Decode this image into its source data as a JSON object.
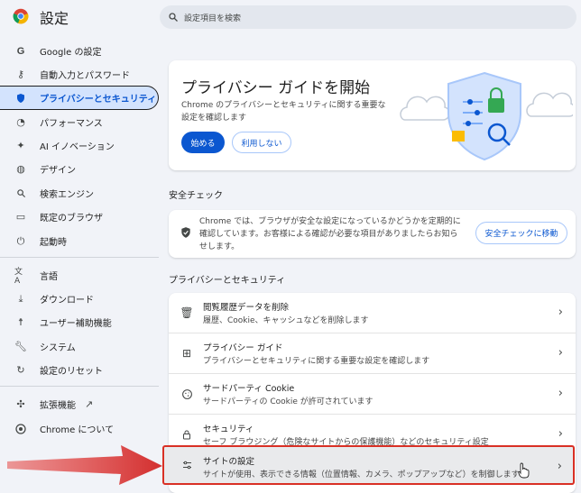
{
  "header": {
    "title": "設定",
    "search_placeholder": "設定項目を検索"
  },
  "sidebar": {
    "items": [
      {
        "label": "Google の設定",
        "icon": "google-icon"
      },
      {
        "label": "自動入力とパスワード",
        "icon": "key-icon"
      },
      {
        "label": "プライバシーとセキュリティ",
        "icon": "shield-icon",
        "active": true
      },
      {
        "label": "パフォーマンス",
        "icon": "speedometer-icon"
      },
      {
        "label": "AI イノベーション",
        "icon": "sparkle-icon"
      },
      {
        "label": "デザイン",
        "icon": "palette-icon"
      },
      {
        "label": "検索エンジン",
        "icon": "search-icon"
      },
      {
        "label": "既定のブラウザ",
        "icon": "browser-window-icon"
      },
      {
        "label": "起動時",
        "icon": "power-icon"
      },
      {
        "label": "言語",
        "icon": "translate-icon"
      },
      {
        "label": "ダウンロード",
        "icon": "download-icon"
      },
      {
        "label": "ユーザー補助機能",
        "icon": "accessibility-icon"
      },
      {
        "label": "システム",
        "icon": "wrench-icon"
      },
      {
        "label": "設定のリセット",
        "icon": "reset-icon"
      },
      {
        "label": "拡張機能",
        "icon": "puzzle-icon"
      },
      {
        "label": "Chrome について",
        "icon": "chrome-icon"
      }
    ]
  },
  "guide": {
    "title": "プライバシー ガイドを開始",
    "description": "Chrome のプライバシーとセキュリティに関する重要な設定を確認します",
    "start_label": "始める",
    "decline_label": "利用しない"
  },
  "safety_check": {
    "section_title": "安全チェック",
    "text": "Chrome では、ブラウザが安全な設定になっているかどうかを定期的に確認しています。お客様による確認が必要な項目がありましたらお知らせします。",
    "button_label": "安全チェックに移動"
  },
  "privacy": {
    "section_title": "プライバシーとセキュリティ",
    "rows": [
      {
        "title": "閲覧履歴データを削除",
        "subtitle": "履歴、Cookie、キャッシュなどを削除します",
        "icon": "trash-icon"
      },
      {
        "title": "プライバシー ガイド",
        "subtitle": "プライバシーとセキュリティに関する重要な設定を確認します",
        "icon": "guide-icon"
      },
      {
        "title": "サードパーティ Cookie",
        "subtitle": "サードパーティの Cookie が許可されています",
        "icon": "cookie-icon"
      },
      {
        "title": "セキュリティ",
        "subtitle": "セーフ ブラウジング（危険なサイトからの保護機能）などのセキュリティ設定",
        "icon": "lock-icon"
      },
      {
        "title": "サイトの設定",
        "subtitle": "サイトが使用、表示できる情報（位置情報、カメラ、ポップアップなど）を制御します",
        "icon": "tune-icon",
        "highlighted": true
      }
    ]
  },
  "colors": {
    "accent": "#0b57d0",
    "active_nav_bg": "#d3e3fd",
    "annotation_red": "#d93025"
  }
}
